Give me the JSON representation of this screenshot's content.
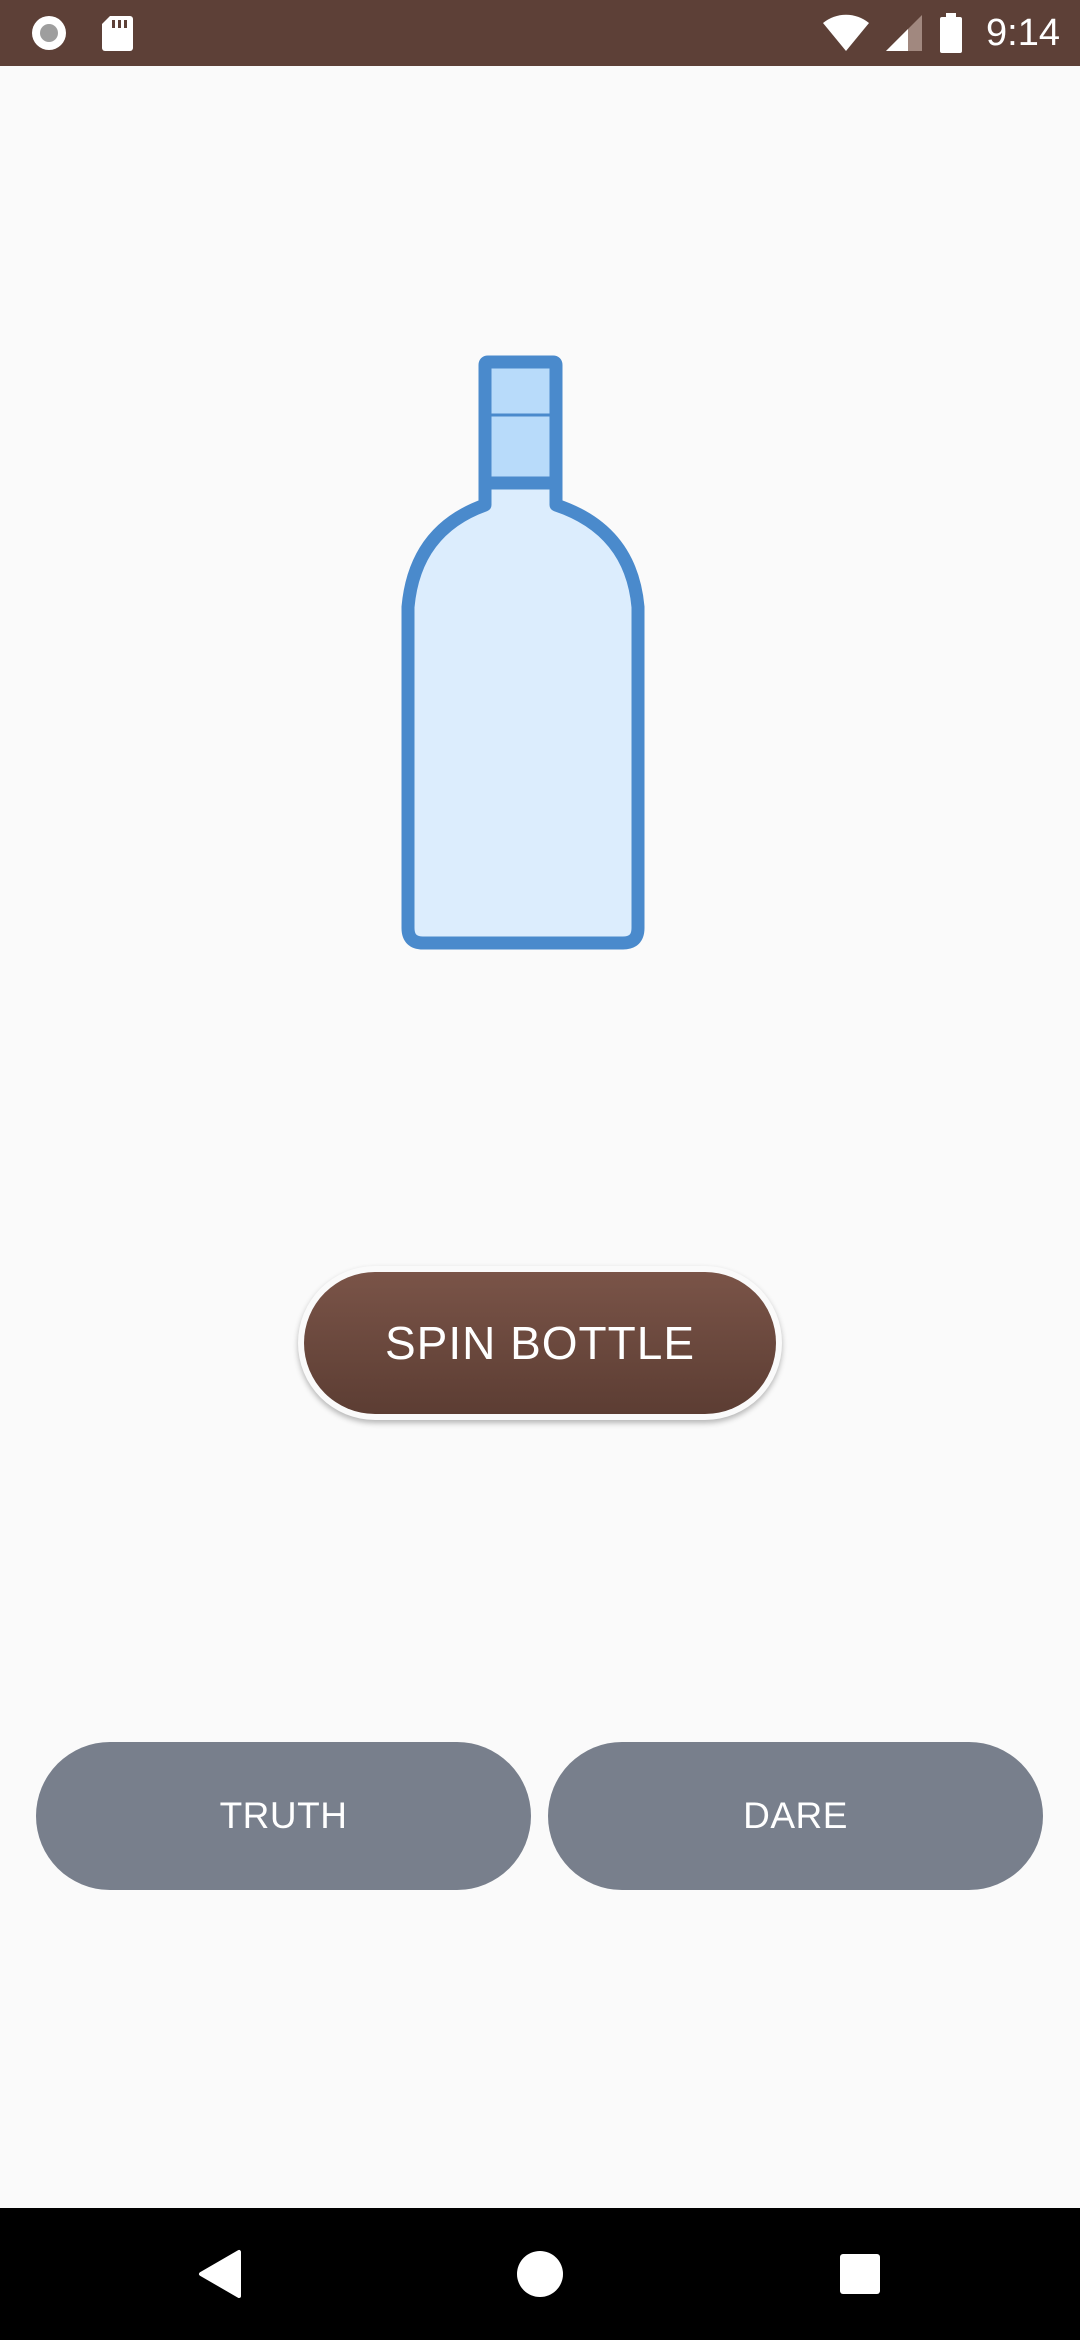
{
  "status_bar": {
    "time": "9:14",
    "background": "#5d4037",
    "icons_left": [
      "record-indicator-icon",
      "sd-card-icon"
    ],
    "icons_right": [
      "wifi-icon",
      "cell-signal-icon",
      "battery-icon"
    ]
  },
  "game": {
    "bottle_icon": "bottle-icon",
    "spin_label": "SPIN BOTTLE",
    "truth_label": "TRUTH",
    "dare_label": "DARE"
  },
  "colors": {
    "spin_button": "#6b4a3f",
    "choice_button": "#787f8c",
    "bottle_outline": "#4a8acc",
    "bottle_fill": "#dcedfd",
    "bottle_cap_fill": "#b8dbfa"
  },
  "nav_bar": {
    "icons": [
      "back-icon",
      "home-icon",
      "recents-icon"
    ]
  }
}
